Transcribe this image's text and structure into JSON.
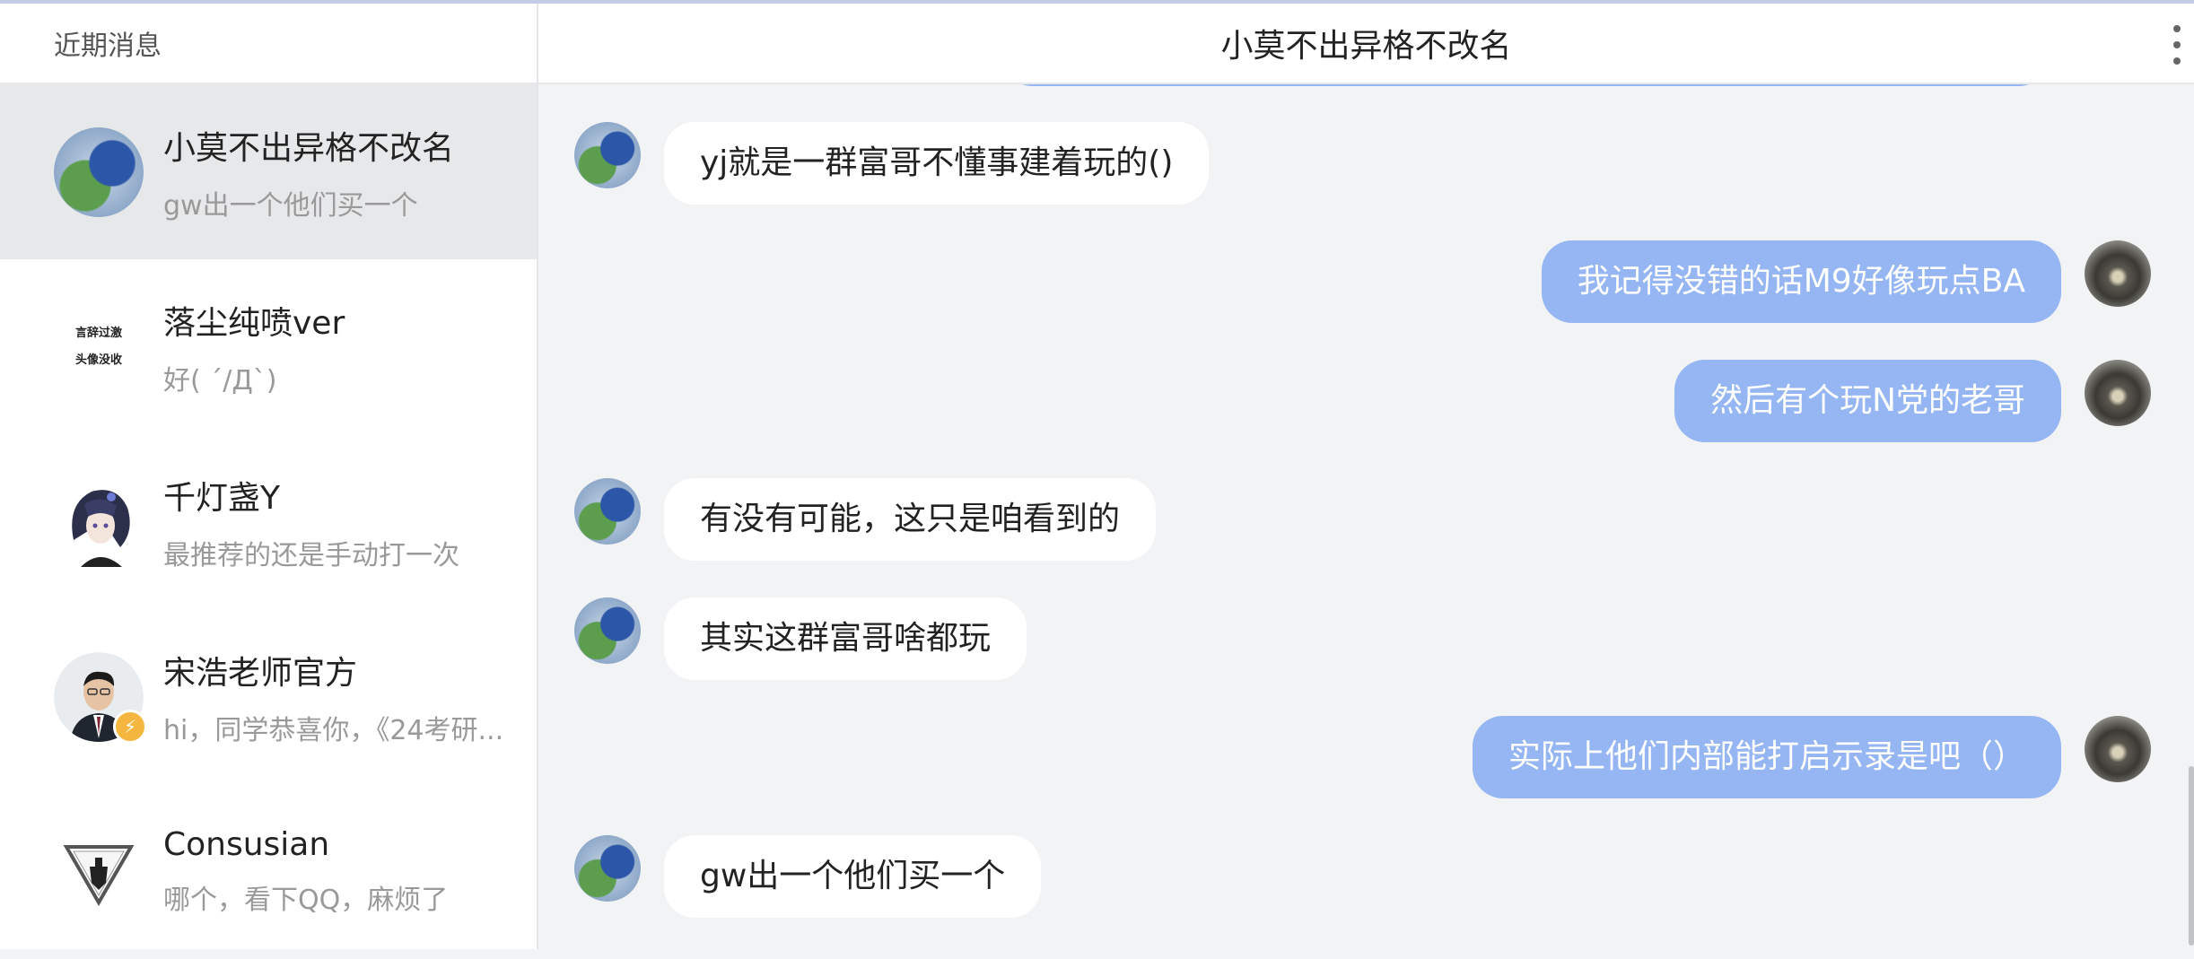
{
  "sidebar": {
    "title": "近期消息",
    "conversations": [
      {
        "name": "小莫不出异格不改名",
        "preview": "gw出一个他们买一个",
        "active": true
      },
      {
        "name": "落尘纯喷ver",
        "preview": "好( ´/Д`)",
        "avatar_text_1": "言辞过激",
        "avatar_text_2": "头像没收"
      },
      {
        "name": "千灯盏Y",
        "preview": "最推荐的还是手动打一次"
      },
      {
        "name": "宋浩老师官方",
        "preview": "hi，同学恭喜你，《24考研...",
        "badge_icon": "lightning-icon"
      },
      {
        "name": "Consusian",
        "preview": "哪个，看下QQ，麻烦了"
      }
    ]
  },
  "chat": {
    "title": "小莫不出异格不改名",
    "messages": [
      {
        "side": "in",
        "text": "yj就是一群富哥不懂事建着玩的()"
      },
      {
        "side": "out",
        "text": "我记得没错的话M9好像玩点BA"
      },
      {
        "side": "out",
        "text": "然后有个玩N党的老哥"
      },
      {
        "side": "in",
        "text": "有没有可能，这只是咱看到的"
      },
      {
        "side": "in",
        "text": "其实这群富哥啥都玩"
      },
      {
        "side": "out",
        "text": "实际上他们内部能打启示录是吧（）"
      },
      {
        "side": "in",
        "text": "gw出一个他们买一个"
      }
    ]
  },
  "colors": {
    "accent_bubble": "#95b6f2",
    "active_row": "#e7e8ea",
    "badge": "#f4b63f"
  }
}
